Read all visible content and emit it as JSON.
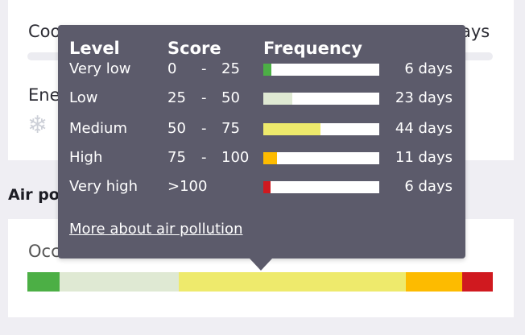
{
  "background": {
    "cooling_label": "Coo",
    "cooling_value": "ays",
    "energy_label": "Ene",
    "section_heading": "Air po",
    "occasion_label": "Occ",
    "snow_icon": "snowflake-icon"
  },
  "scale_bar": [
    {
      "color": "#4caf45",
      "fraction": 0.069
    },
    {
      "color": "#dfe9d3",
      "fraction": 0.256
    },
    {
      "color": "#eeea6c",
      "fraction": 0.488
    },
    {
      "color": "#fdbb00",
      "fraction": 0.121
    },
    {
      "color": "#d0191f",
      "fraction": 0.066
    }
  ],
  "tooltip": {
    "headers": {
      "level": "Level",
      "score": "Score",
      "frequency": "Frequency"
    },
    "rows": [
      {
        "level": "Very low",
        "score_low": "0",
        "dash": "-",
        "score_high": "25",
        "days": "6 days",
        "color": "#4caf45",
        "fill": 0.07
      },
      {
        "level": "Low",
        "score_low": "25",
        "dash": "-",
        "score_high": "50",
        "days": "23 days",
        "color": "#dfe9d3",
        "fill": 0.25
      },
      {
        "level": "Medium",
        "score_low": "50",
        "dash": "-",
        "score_high": "75",
        "days": "44 days",
        "color": "#eeea6c",
        "fill": 0.49
      },
      {
        "level": "High",
        "score_low": "75",
        "dash": "-",
        "score_high": "100",
        "days": "11 days",
        "color": "#fdbb00",
        "fill": 0.12
      },
      {
        "level": "Very high",
        "score_low": ">100",
        "dash": "",
        "score_high": "",
        "days": "6 days",
        "color": "#d0191f",
        "fill": 0.06
      }
    ],
    "more_link": "More about air pollution"
  }
}
